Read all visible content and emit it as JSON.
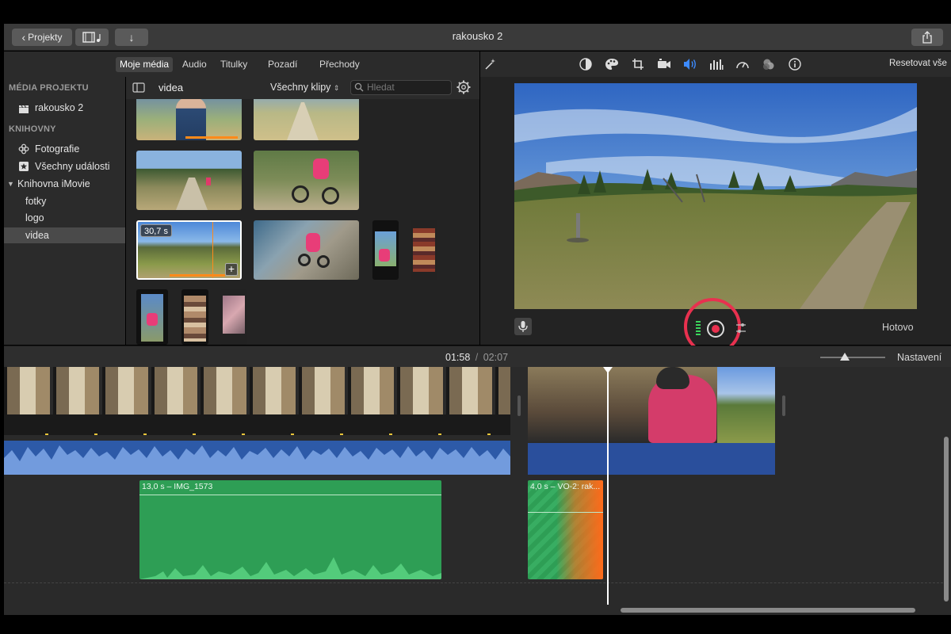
{
  "window": {
    "title": "rakousko 2",
    "projects_label": "Projekty"
  },
  "browser_tabs": [
    {
      "label": "Moje média",
      "active": true
    },
    {
      "label": "Audio",
      "active": false
    },
    {
      "label": "Titulky",
      "active": false
    },
    {
      "label": "Pozadí",
      "active": false
    },
    {
      "label": "Přechody",
      "active": false
    }
  ],
  "viewer_toolbar": {
    "reset_label": "Resetovat vše",
    "icons": [
      "magic-wand-icon",
      "color-balance-icon",
      "color-palette-icon",
      "crop-icon",
      "camera-stabilize-icon",
      "volume-icon",
      "equalizer-icon",
      "speed-icon",
      "filter-icon",
      "info-icon"
    ],
    "active_icon": "volume-icon"
  },
  "sidebar": {
    "project_media_header": "MÉDIA PROJEKTU",
    "project_item": "rakousko 2",
    "libraries_header": "KNIHOVNY",
    "items": [
      {
        "label": "Fotografie"
      },
      {
        "label": "Všechny události"
      },
      {
        "label": "Knihovna iMovie"
      },
      {
        "label": "fotky"
      },
      {
        "label": "logo"
      },
      {
        "label": "videa",
        "selected": true
      }
    ]
  },
  "browser": {
    "folder_title": "videa",
    "filter_label": "Všechny klipy",
    "search_placeholder": "Hledat",
    "selected_clip_duration": "30,7 s"
  },
  "viewer": {
    "done_label": "Hotovo"
  },
  "timeline": {
    "current_time": "01:58",
    "separator": "/",
    "total_time": "02:07",
    "settings_label": "Nastavení",
    "zoom_level": 0.4,
    "audio_clips": [
      {
        "label": "13,0 s – IMG_1573"
      },
      {
        "label": "4,0 s – VO-2: rak..."
      }
    ]
  },
  "colors": {
    "accent_blue": "#3d8bff",
    "audio_green": "#2e9e55",
    "clip_blue": "#2a4f9c",
    "record_circle": "#e8314f",
    "orange": "#ff6a1a"
  }
}
